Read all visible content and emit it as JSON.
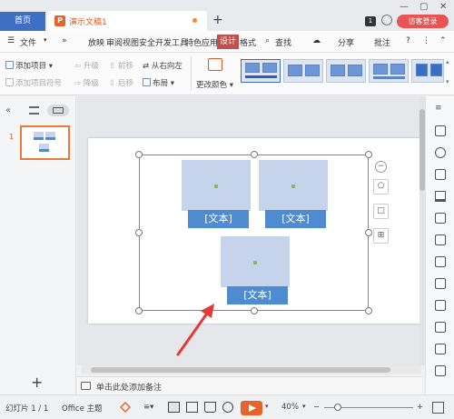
{
  "titlebar": {
    "home_tab": "首页",
    "doc_tab": "演示文稿1",
    "doc_icon_letter": "P",
    "new_tab": "+",
    "badge": "1",
    "login": "访客登录"
  },
  "menubar": {
    "file": "文件",
    "items": [
      "放映",
      "审阅",
      "视图",
      "安全",
      "开发工具",
      "特色应用"
    ],
    "active": "设计",
    "format": "格式",
    "search": "查找",
    "share": "分享",
    "annotate": "批注",
    "help": "?"
  },
  "ribbon": {
    "add_item": "添加项目",
    "add_bullet": "添加项目符号",
    "promote": "升级",
    "demote": "降级",
    "move_up": "前移",
    "move_down": "后移",
    "rtl": "从右向左",
    "layout": "布局",
    "change_color": "更改颜色",
    "styles_count": 5
  },
  "slides_panel": {
    "slide_number": "1",
    "add": "+"
  },
  "slide": {
    "cards": [
      {
        "label": "[文本]"
      },
      {
        "label": "[文本]"
      },
      {
        "label": "[文本]"
      }
    ]
  },
  "notes": {
    "placeholder": "单击此处添加备注"
  },
  "statusbar": {
    "slide_info": "幻灯片 1 / 1",
    "theme": "Office 主题",
    "zoom": "40%",
    "zoom_minus": "−",
    "zoom_plus": "+"
  },
  "colors": {
    "accent_orange": "#e8632a",
    "design_tab": "#c0504d",
    "card_label": "#4f8bd0",
    "card_fill": "#c5d4ea",
    "arrow": "#e53935"
  }
}
